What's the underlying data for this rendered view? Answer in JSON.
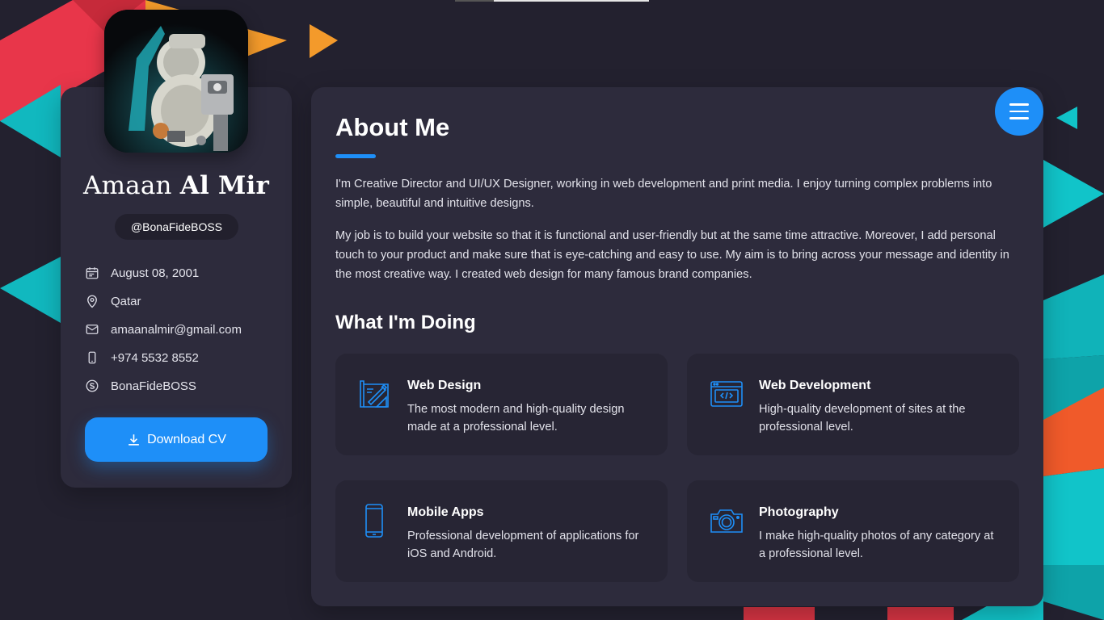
{
  "colors": {
    "background": "#23212f",
    "card": "#2d2b3c",
    "service_card": "#272534",
    "accent": "#1e8ff8"
  },
  "profile": {
    "avatar_icon": "robot-avatar-image",
    "first_name": "Amaan",
    "last_name": "Al Mir",
    "handle": "@BonaFideBOSS",
    "contacts": [
      {
        "icon": "calendar-icon",
        "text": "August 08, 2001"
      },
      {
        "icon": "location-pin-icon",
        "text": "Qatar"
      },
      {
        "icon": "mail-icon",
        "text": "amaanalmir@gmail.com"
      },
      {
        "icon": "phone-icon",
        "text": "+974 5532 8552"
      },
      {
        "icon": "skype-icon",
        "text": "BonaFideBOSS"
      }
    ],
    "download_label": "Download CV"
  },
  "menu": {
    "icon": "hamburger-menu-icon"
  },
  "about": {
    "title": "About Me",
    "paragraphs": [
      "I'm Creative Director and UI/UX Designer, working in web development and print media. I enjoy turning complex problems into simple, beautiful and intuitive designs.",
      "My job is to build your website so that it is functional and user-friendly but at the same time attractive. Moreover, I add personal touch to your product and make sure that is eye-catching and easy to use. My aim is to bring across your message and identity in the most creative way. I created web design for many famous brand companies."
    ]
  },
  "doing": {
    "title": "What I'm Doing",
    "services": [
      {
        "icon": "design-blueprint-icon",
        "title": "Web Design",
        "desc": "The most modern and high-quality design made at a professional level."
      },
      {
        "icon": "code-window-icon",
        "title": "Web Development",
        "desc": "High-quality development of sites at the professional level."
      },
      {
        "icon": "smartphone-icon",
        "title": "Mobile Apps",
        "desc": "Professional development of applications for iOS and Android."
      },
      {
        "icon": "camera-icon",
        "title": "Photography",
        "desc": "I make high-quality photos of any category at a professional level."
      }
    ]
  }
}
